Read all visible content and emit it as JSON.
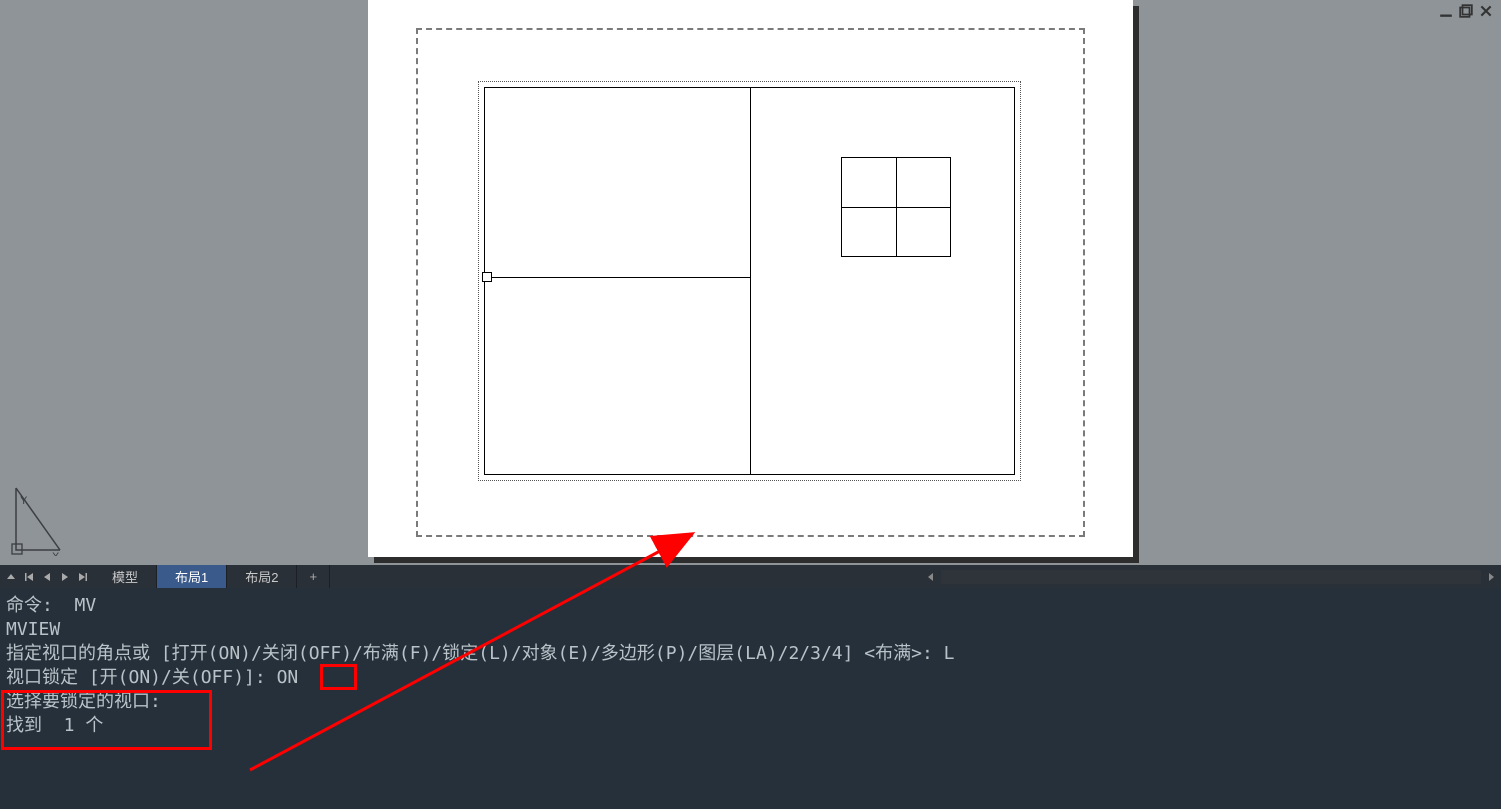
{
  "window": {
    "minimize_title": "Minimize",
    "restore_title": "Restore",
    "close_title": "Close"
  },
  "ucs": {
    "x_label": "X",
    "y_label": "Y"
  },
  "tabs": {
    "model": "模型",
    "layout1": "布局1",
    "layout2": "布局2",
    "add": "+"
  },
  "command": {
    "line1": "命令:  MV",
    "line2": "MVIEW",
    "line3": "指定视口的角点或 [打开(ON)/关闭(OFF)/布满(F)/锁定(L)/对象(E)/多边形(P)/图层(LA)/2/3/4] <布满>: L",
    "line4_prefix": "视口锁定 [开(ON)/关(OFF)]: ",
    "line4_value": "ON",
    "line5": "选择要锁定的视口:",
    "line6": "找到  1 个"
  }
}
